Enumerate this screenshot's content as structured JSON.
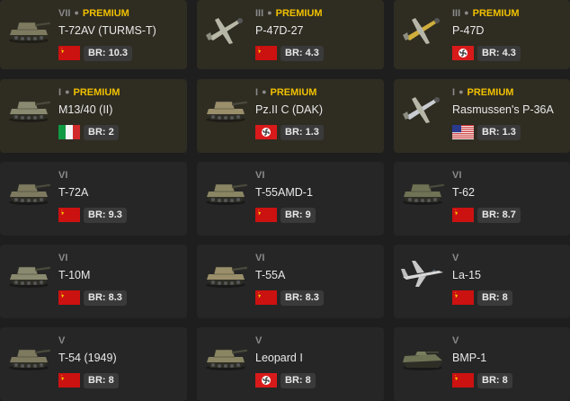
{
  "cards": [
    {
      "tier": "VII",
      "premium": true,
      "premium_label": "PREMIUM",
      "name": "T-72AV (TURMS-T)",
      "nation": "ussr",
      "br": "BR: 10.3",
      "icon": "tank-icon"
    },
    {
      "tier": "III",
      "premium": true,
      "premium_label": "PREMIUM",
      "name": "P-47D-27",
      "nation": "ussr",
      "br": "BR: 4.3",
      "icon": "aircraft-icon"
    },
    {
      "tier": "III",
      "premium": true,
      "premium_label": "PREMIUM",
      "name": "P-47D",
      "nation": "germany",
      "br": "BR: 4.3",
      "icon": "aircraft-icon"
    },
    {
      "tier": "I",
      "premium": true,
      "premium_label": "PREMIUM",
      "name": "M13/40 (II)",
      "nation": "italy",
      "br": "BR: 2",
      "icon": "tank-icon"
    },
    {
      "tier": "I",
      "premium": true,
      "premium_label": "PREMIUM",
      "name": "Pz.II C (DAK)",
      "nation": "germany",
      "br": "BR: 1.3",
      "icon": "tank-icon"
    },
    {
      "tier": "I",
      "premium": true,
      "premium_label": "PREMIUM",
      "name": "Rasmussen's P-36A",
      "nation": "usa",
      "br": "BR: 1.3",
      "icon": "aircraft-icon"
    },
    {
      "tier": "VI",
      "premium": false,
      "name": "T-72A",
      "nation": "ussr",
      "br": "BR: 9.3",
      "icon": "tank-icon"
    },
    {
      "tier": "VI",
      "premium": false,
      "name": "T-55AMD-1",
      "nation": "ussr",
      "br": "BR: 9",
      "icon": "tank-icon"
    },
    {
      "tier": "VI",
      "premium": false,
      "name": "T-62",
      "nation": "ussr",
      "br": "BR: 8.7",
      "icon": "tank-icon"
    },
    {
      "tier": "VI",
      "premium": false,
      "name": "T-10M",
      "nation": "ussr",
      "br": "BR: 8.3",
      "icon": "tank-icon"
    },
    {
      "tier": "VI",
      "premium": false,
      "name": "T-55A",
      "nation": "ussr",
      "br": "BR: 8.3",
      "icon": "tank-icon"
    },
    {
      "tier": "V",
      "premium": false,
      "name": "La-15",
      "nation": "ussr",
      "br": "BR: 8",
      "icon": "jet-icon"
    },
    {
      "tier": "V",
      "premium": false,
      "name": "T-54 (1949)",
      "nation": "ussr",
      "br": "BR: 8",
      "icon": "tank-icon"
    },
    {
      "tier": "V",
      "premium": false,
      "name": "Leopard I",
      "nation": "germany",
      "br": "BR: 8",
      "icon": "tank-icon"
    },
    {
      "tier": "V",
      "premium": false,
      "name": "BMP-1",
      "nation": "ussr",
      "br": "BR: 8",
      "icon": "ifv-icon"
    }
  ],
  "colors": {
    "premium_gold": "#f0c000",
    "card_bg": "#262626",
    "card_premium_bg": "#2f2c22",
    "badge_bg": "#3a3a3a"
  }
}
